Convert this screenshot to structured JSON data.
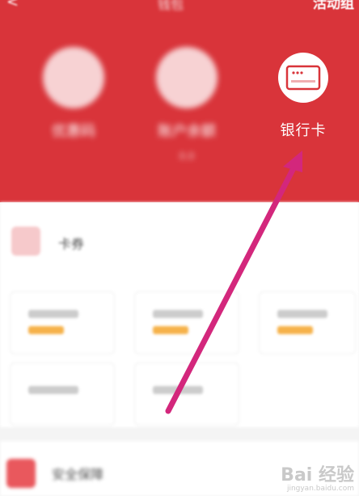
{
  "header": {
    "back_icon": "chevron-left-icon",
    "title": "钱包",
    "right_link": "活动组"
  },
  "tiles": [
    {
      "label": "优惠码",
      "sub": "",
      "icon": "coupon-icon"
    },
    {
      "label": "账户余额",
      "sub": "0.0",
      "icon": "wallet-yuan-icon"
    },
    {
      "label": "银行卡",
      "sub": "",
      "icon": "bank-card-icon"
    }
  ],
  "sections": [
    {
      "title": "卡券",
      "icon": "card-icon"
    },
    {
      "title": "安全保障",
      "icon": "shield-icon"
    }
  ],
  "watermark": {
    "text": "Bai 经验",
    "sub": "jingyan.baidu.com"
  },
  "colors": {
    "header_bg": "#d9343a",
    "arrow": "#d3277c"
  }
}
